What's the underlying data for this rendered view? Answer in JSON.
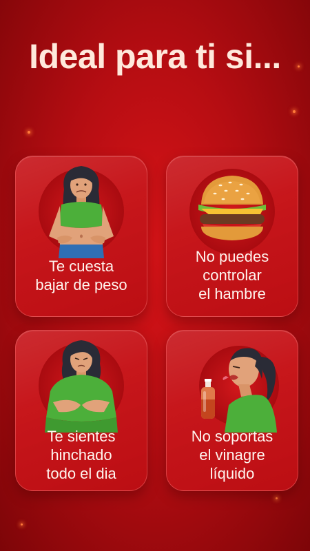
{
  "title": "Ideal para ti si...",
  "cards": [
    {
      "label_lines": [
        "Te cuesta",
        "bajar de peso"
      ],
      "icon": "woman-belly-icon"
    },
    {
      "label_lines": [
        "No puedes",
        "controlar",
        "el hambre"
      ],
      "icon": "burger-icon"
    },
    {
      "label_lines": [
        "Te sientes",
        "hinchado",
        "todo el dia"
      ],
      "icon": "bloated-woman-icon"
    },
    {
      "label_lines": [
        "No soportas",
        "el vinagre",
        "líquido"
      ],
      "icon": "vinegar-disgust-icon"
    }
  ],
  "colors": {
    "background": "#c0101a",
    "title": "#ffe9dc",
    "card_text": "#fff4ee",
    "shirt": "#4caf3a"
  }
}
